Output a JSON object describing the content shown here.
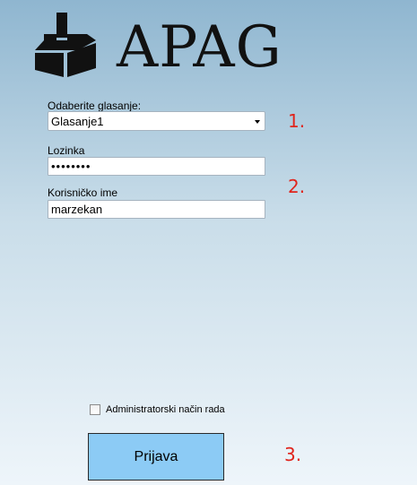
{
  "app": {
    "logo_text": "APAG",
    "logo_icon": "ballot-box-icon"
  },
  "form": {
    "voting_label": "Odaberite glasanje:",
    "voting_selected": "Glasanje1",
    "password_label": "Lozinka",
    "password_value": "••••••••",
    "username_label": "Korisničko ime",
    "username_value": "marzekan",
    "admin_mode_label": "Administratorski način rada",
    "admin_mode_checked": false,
    "login_button_label": "Prijava"
  },
  "annotations": {
    "step1": "1.",
    "step2": "2.",
    "step3": "3.",
    "color": "#e0241c"
  },
  "colors": {
    "button_bg": "#8ccbf5",
    "background_top": "#8fb6d0",
    "background_bottom": "#eef5fa"
  }
}
